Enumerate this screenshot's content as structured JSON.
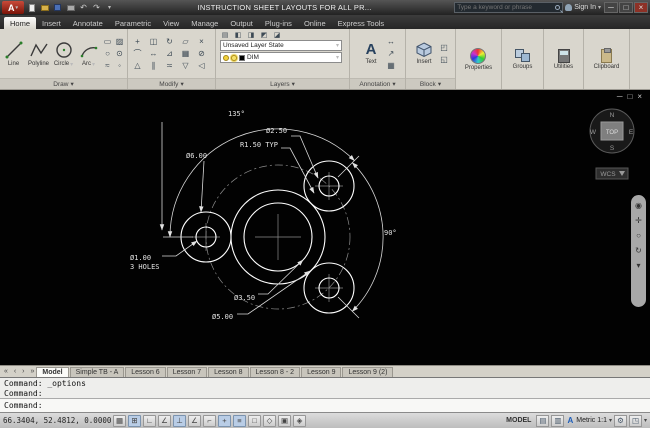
{
  "icons": {
    "dropdown": "▾",
    "minimize": "─",
    "restore": "□",
    "close": "×",
    "undo": "↶",
    "redo": "↷",
    "app_logo": "A",
    "tab_nav": [
      "«",
      "‹",
      "›",
      "»"
    ]
  },
  "title_bar": {
    "title": "INSTRUCTION SHEET LAYOUTS FOR ALL PR...",
    "search_placeholder": "Type a keyword or phrase",
    "sign_in_label": "Sign In"
  },
  "ribbon_tabs": [
    "Home",
    "Insert",
    "Annotate",
    "Parametric",
    "View",
    "Manage",
    "Output",
    "Plug-ins",
    "Online",
    "Express Tools"
  ],
  "ribbon": {
    "draw": {
      "panel_label": "Draw",
      "tool_labels": [
        "Line",
        "Polyline",
        "Circle",
        "Arc"
      ],
      "small_tool_icons": [
        "▭",
        "▨",
        "○",
        "⊙",
        "≈",
        "◦"
      ]
    },
    "modify": {
      "panel_label": "Modify",
      "tool_icons": [
        "+",
        "◫",
        "↻",
        "▱",
        "×",
        "⌒",
        "↔",
        "⊿",
        "▦",
        "⊘",
        "△",
        "∥",
        "≍",
        "▽",
        "◁"
      ]
    },
    "layers": {
      "panel_label": "Layers",
      "row_icons": [
        "▤",
        "◧",
        "◨",
        "◩",
        "◪"
      ],
      "layer_state_value": "Unsaved Layer State",
      "current_layer": "DIM"
    },
    "annotation": {
      "panel_label": "Annotation",
      "text_tool_label": "Text",
      "text_icon": "A",
      "small_icons": [
        "↔",
        "↗",
        "▦"
      ]
    },
    "block": {
      "panel_label": "Block",
      "insert_tool_label": "Insert",
      "small_icons": [
        "◰",
        "◱"
      ]
    },
    "properties_label": "Properties",
    "groups_label": "Groups",
    "utilities_label": "Utilities",
    "clipboard_label": "Clipboard"
  },
  "drawing": {
    "dimensions": {
      "angle_top": "135°",
      "dia_bolt_hole": "Ø2.50",
      "radius_typ": "R1.50 TYP",
      "dia_lobe": "Ø6.00",
      "hole_note_line1": "Ø1.00",
      "hole_note_line2": "3 HOLES",
      "dia_inner": "Ø3.50",
      "dia_outer": "Ø5.00",
      "angle_right": "90°"
    },
    "viewcube": {
      "north": "N",
      "south": "S",
      "east": "E",
      "west": "W",
      "top_face": "TOP",
      "wcs_label": "WCS"
    }
  },
  "layout_tabs": [
    "Model",
    "Simple TB - A",
    "Lesson 6",
    "Lesson 7",
    "Lesson 8",
    "Lesson 8 - 2",
    "Lesson 9",
    "Lesson 9 (2)"
  ],
  "command_line": {
    "history": [
      "Command: _options",
      "Command:"
    ],
    "prompt": "Command:"
  },
  "status_bar": {
    "coordinates": "66.3404, 52.4812, 0.0000",
    "toggle_icons": [
      "▦",
      "⊞",
      "∟",
      "∠",
      "⊥",
      "∠",
      "⌐",
      "+",
      "≡",
      "□",
      "◇",
      "▣",
      "◈"
    ],
    "model_label": "MODEL",
    "right_icons": [
      "▤",
      "▥"
    ],
    "annotation_icon": "A",
    "annotation_scale": "Metric 1:1",
    "tail_icons": [
      "⚙",
      "◳"
    ]
  }
}
